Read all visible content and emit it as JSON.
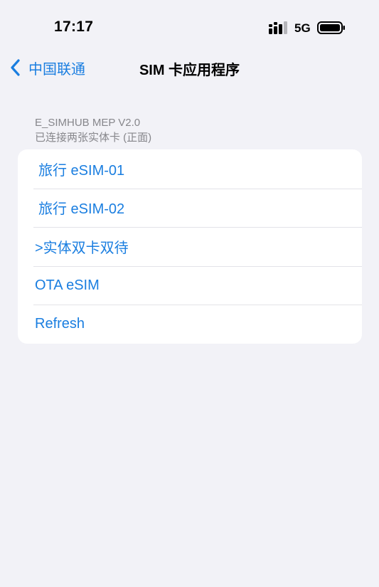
{
  "status_bar": {
    "time": "17:17",
    "network": "5G",
    "signal_icon": "signal-bars-icon",
    "battery_icon": "battery-icon"
  },
  "nav": {
    "back_label": "中国联通",
    "back_icon": "chevron-left-icon",
    "title": "SIM 卡应用程序"
  },
  "section": {
    "header_line1": "E_SIMHUB MEP V2.0",
    "header_line2": "已连接两张实体卡 (正面)"
  },
  "list": {
    "items": [
      {
        "label": "旅行 eSIM-01"
      },
      {
        "label": "旅行 eSIM-02"
      },
      {
        "label": ">实体双卡双待"
      },
      {
        "label": "OTA eSIM"
      },
      {
        "label": "Refresh"
      }
    ]
  },
  "colors": {
    "accent": "#1a7ee0",
    "background": "#f2f2f7",
    "card": "#ffffff",
    "secondary_text": "#86868b"
  }
}
